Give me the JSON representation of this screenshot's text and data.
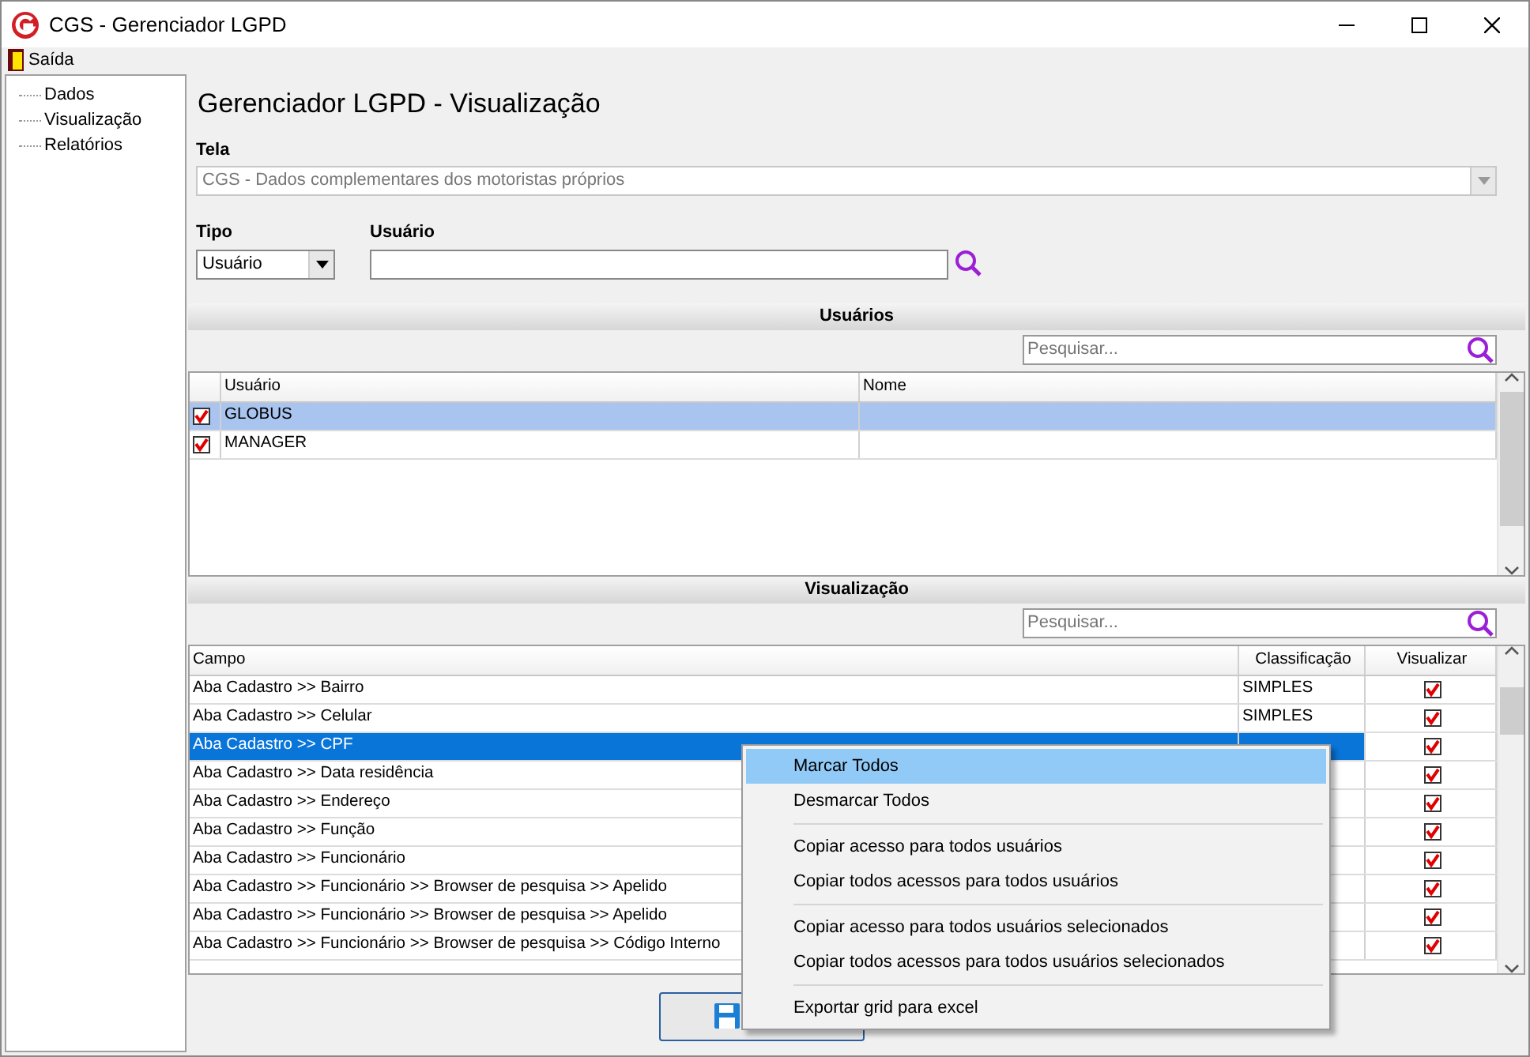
{
  "window": {
    "title": "CGS - Gerenciador LGPD"
  },
  "menu_bar": [
    {
      "label": "Saída"
    }
  ],
  "sidebar": {
    "items": [
      {
        "label": "Dados"
      },
      {
        "label": "Visualização"
      },
      {
        "label": "Relatórios"
      }
    ]
  },
  "heading": "Gerenciador LGPD - Visualização",
  "tela": {
    "label": "Tela",
    "value": "CGS - Dados complementares dos motoristas próprios"
  },
  "tipo": {
    "label": "Tipo",
    "value": "Usuário"
  },
  "usuario": {
    "label": "Usuário"
  },
  "users_section": {
    "title": "Usuários",
    "search": {
      "placeholder": "Pesquisar..."
    },
    "columns": [
      "Usuário",
      "Nome"
    ],
    "rows": [
      {
        "usuario": "GLOBUS",
        "checked": true,
        "selected": true
      },
      {
        "usuario": "MANAGER",
        "checked": true,
        "selected": false
      }
    ]
  },
  "view_section": {
    "title": "Visualização",
    "search": {
      "placeholder": "Pesquisar..."
    },
    "columns": [
      "Campo",
      "Classificação",
      "Visualizar"
    ],
    "rows": [
      {
        "campo": "Aba Cadastro >> Bairro",
        "classificacao": "SIMPLES",
        "visualizar": true,
        "selected": false
      },
      {
        "campo": "Aba Cadastro >> Celular",
        "classificacao": "SIMPLES",
        "visualizar": true,
        "selected": false
      },
      {
        "campo": "Aba Cadastro >> CPF",
        "visualizar": true,
        "selected": true
      },
      {
        "campo": "Aba Cadastro >> Data residência",
        "visualizar": true,
        "selected": false
      },
      {
        "campo": "Aba Cadastro >> Endereço",
        "visualizar": true,
        "selected": false
      },
      {
        "campo": "Aba Cadastro >> Função",
        "visualizar": true,
        "selected": false
      },
      {
        "campo": "Aba Cadastro >> Funcionário",
        "visualizar": true,
        "selected": false
      },
      {
        "campo": "Aba Cadastro >> Funcionário >> Browser de pesquisa >> Apelido",
        "visualizar": true,
        "selected": false
      },
      {
        "campo": "Aba Cadastro >> Funcionário >> Browser de pesquisa >> Apelido",
        "visualizar": true,
        "selected": false
      },
      {
        "campo": "Aba Cadastro >> Funcionário >> Browser de pesquisa >> Código Interno",
        "visualizar": true,
        "selected": false
      }
    ]
  },
  "context_menu": {
    "groups": [
      [
        {
          "label": "Marcar Todos",
          "selected": true
        },
        {
          "label": "Desmarcar Todos",
          "selected": false
        }
      ],
      [
        {
          "label": "Copiar acesso para todos usuários",
          "selected": false
        },
        {
          "label": "Copiar todos acessos para todos usuários",
          "selected": false
        }
      ],
      [
        {
          "label": "Copiar acesso para todos usuários selecionados",
          "selected": false
        },
        {
          "label": "Copiar todos acessos para todos usuários selecionados",
          "selected": false
        }
      ],
      [
        {
          "label": "Exportar grid para excel",
          "selected": false
        }
      ]
    ]
  }
}
